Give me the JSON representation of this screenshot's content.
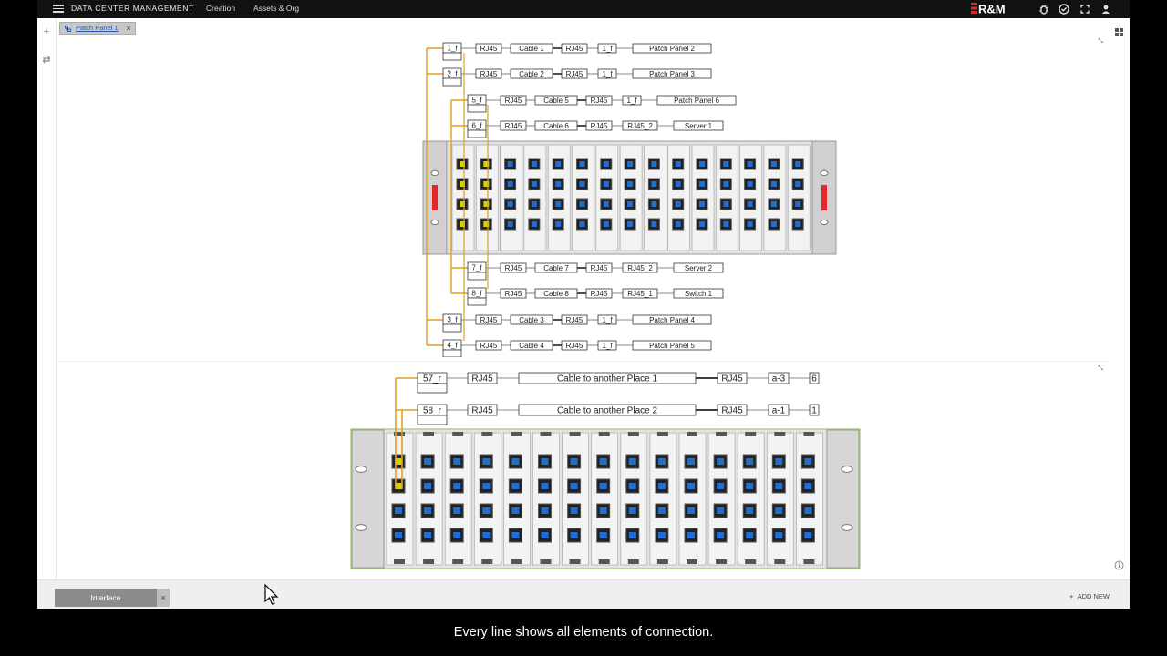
{
  "app": {
    "brand": "DATA CENTER MANAGEMENT",
    "nav": [
      "Creation",
      "Assets & Org"
    ],
    "logo": "R&M"
  },
  "tab": {
    "label": "Patch Panel 1",
    "close": "×"
  },
  "top_connections": [
    {
      "port": "1_f",
      "connector_a": "RJ45",
      "cable": "Cable 1",
      "connector_b": "RJ45",
      "remote_port": "1_f",
      "target": "Patch Panel 2"
    },
    {
      "port": "2_f",
      "connector_a": "RJ45",
      "cable": "Cable 2",
      "connector_b": "RJ45",
      "remote_port": "1_f",
      "target": "Patch Panel 3"
    },
    {
      "port": "5_f",
      "connector_a": "RJ45",
      "cable": "Cable 5",
      "connector_b": "RJ45",
      "remote_port": "1_f",
      "target": "Patch Panel 6"
    },
    {
      "port": "6_f",
      "connector_a": "RJ45",
      "cable": "Cable 6",
      "connector_b": "RJ45",
      "remote_port": "RJ45_2",
      "target": "Server 1"
    },
    {
      "port": "7_f",
      "connector_a": "RJ45",
      "cable": "Cable 7",
      "connector_b": "RJ45",
      "remote_port": "RJ45_2",
      "target": "Server 2"
    },
    {
      "port": "8_f",
      "connector_a": "RJ45",
      "cable": "Cable 8",
      "connector_b": "RJ45",
      "remote_port": "RJ45_1",
      "target": "Switch 1"
    },
    {
      "port": "3_f",
      "connector_a": "RJ45",
      "cable": "Cable 3",
      "connector_b": "RJ45",
      "remote_port": "1_f",
      "target": "Patch Panel 4"
    },
    {
      "port": "4_f",
      "connector_a": "RJ45",
      "cable": "Cable 4",
      "connector_b": "RJ45",
      "remote_port": "1_f",
      "target": "Patch Panel 5"
    }
  ],
  "bottom_connections": [
    {
      "port": "57_r",
      "connector_a": "RJ45",
      "cable": "Cable to another Place 1",
      "connector_b": "RJ45",
      "remote_port": "a-3",
      "target": "6"
    },
    {
      "port": "58_r",
      "connector_a": "RJ45",
      "cable": "Cable to another Place 2",
      "connector_b": "RJ45",
      "remote_port": "a-1",
      "target": "1"
    }
  ],
  "interface_tab": {
    "label": "Interface",
    "close": "×"
  },
  "add_new": "ADD NEW",
  "subtitle": "Every line shows all elements of connection.",
  "colors": {
    "accent": "#e5262b",
    "cable": "#e0a020",
    "port_blue": "#1f6fd0",
    "port_yellow": "#d4d400"
  }
}
